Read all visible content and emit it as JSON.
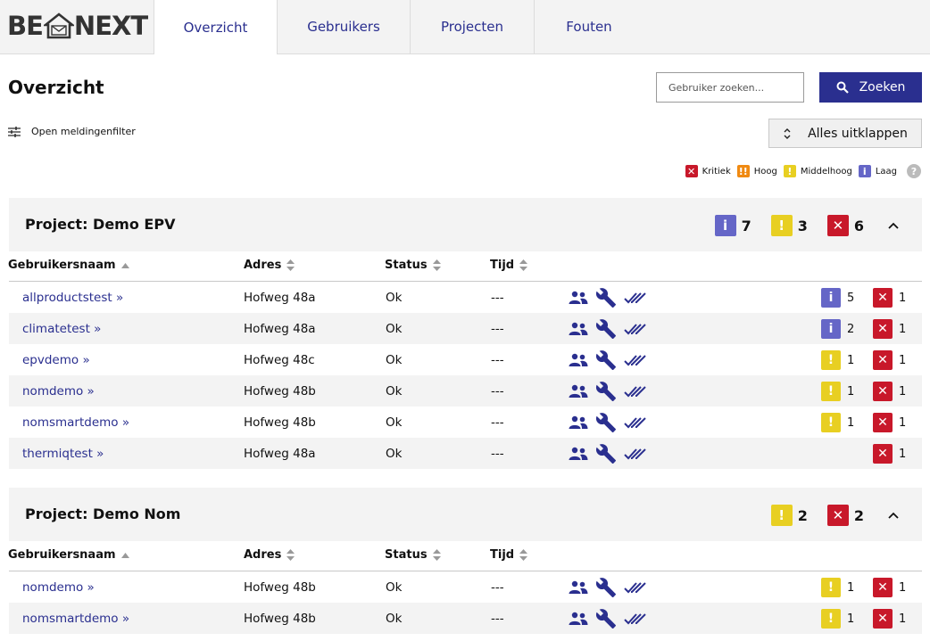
{
  "colors": {
    "accent": "#2a2f8f",
    "info": "#6566c7",
    "warning": "#e8cf22",
    "critical": "#c8182a",
    "high": "#f08a12"
  },
  "logo": {
    "left": "BE",
    "right": "NEXT"
  },
  "tabs": [
    {
      "label": "Overzicht",
      "active": true
    },
    {
      "label": "Gebruikers",
      "active": false
    },
    {
      "label": "Projecten",
      "active": false
    },
    {
      "label": "Fouten",
      "active": false
    }
  ],
  "page": {
    "title": "Overzicht",
    "search_placeholder": "Gebruiker zoeken...",
    "search_button": "Zoeken",
    "filter_link": "Open meldingenfilter",
    "expand_button": "Alles uitklappen"
  },
  "legend": [
    {
      "label": "Kritiek",
      "type": "critical"
    },
    {
      "label": "Hoog",
      "type": "high"
    },
    {
      "label": "Middelhoog",
      "type": "warning"
    },
    {
      "label": "Laag",
      "type": "info"
    }
  ],
  "columns": {
    "username": "Gebruikersnaam",
    "address": "Adres",
    "status": "Status",
    "time": "Tijd"
  },
  "projects": [
    {
      "title": "Project: Demo EPV",
      "counts": {
        "info": "7",
        "warning": "3",
        "critical": "6"
      },
      "rows": [
        {
          "user": "allproductstest »",
          "address": "Hofweg 48a",
          "status": "Ok",
          "time": "---",
          "info": "5",
          "warning": null,
          "critical": "1"
        },
        {
          "user": "climatetest »",
          "address": "Hofweg 48a",
          "status": "Ok",
          "time": "---",
          "info": "2",
          "warning": null,
          "critical": "1"
        },
        {
          "user": "epvdemo »",
          "address": "Hofweg 48c",
          "status": "Ok",
          "time": "---",
          "info": null,
          "warning": "1",
          "critical": "1"
        },
        {
          "user": "nomdemo »",
          "address": "Hofweg 48b",
          "status": "Ok",
          "time": "---",
          "info": null,
          "warning": "1",
          "critical": "1"
        },
        {
          "user": "nomsmartdemo »",
          "address": "Hofweg 48b",
          "status": "Ok",
          "time": "---",
          "info": null,
          "warning": "1",
          "critical": "1"
        },
        {
          "user": "thermiqtest »",
          "address": "Hofweg 48a",
          "status": "Ok",
          "time": "---",
          "info": null,
          "warning": null,
          "critical": "1"
        }
      ]
    },
    {
      "title": "Project: Demo Nom",
      "counts": {
        "info": null,
        "warning": "2",
        "critical": "2"
      },
      "rows": [
        {
          "user": "nomdemo »",
          "address": "Hofweg 48b",
          "status": "Ok",
          "time": "---",
          "info": null,
          "warning": "1",
          "critical": "1"
        },
        {
          "user": "nomsmartdemo »",
          "address": "Hofweg 48b",
          "status": "Ok",
          "time": "---",
          "info": null,
          "warning": "1",
          "critical": "1"
        }
      ]
    }
  ]
}
